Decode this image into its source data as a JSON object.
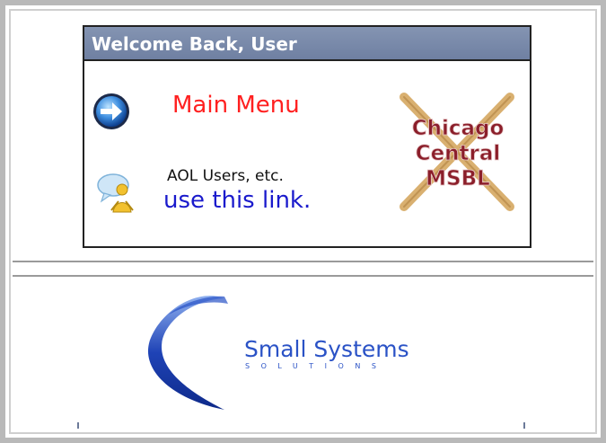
{
  "welcome": {
    "title": "Welcome Back, User"
  },
  "links": {
    "main_menu": "Main Menu",
    "aol_label": "AOL Users, etc.",
    "aol_link": "use this link."
  },
  "logo": {
    "lines": [
      "Chicago",
      "Central",
      "MSBL"
    ],
    "icon": "crossed-bats-logo"
  },
  "brand": {
    "name": "Small Systems",
    "tagline": "SOLUTIONS"
  },
  "icons": {
    "arrow": "arrow-right-circle-icon",
    "chat": "chat-user-icon"
  },
  "colors": {
    "header_bg": "#7585a6",
    "main_menu": "#ff2020",
    "aol_link": "#1a1acc",
    "brand": "#2a52c6",
    "logo_text": "#8b1e2a"
  }
}
